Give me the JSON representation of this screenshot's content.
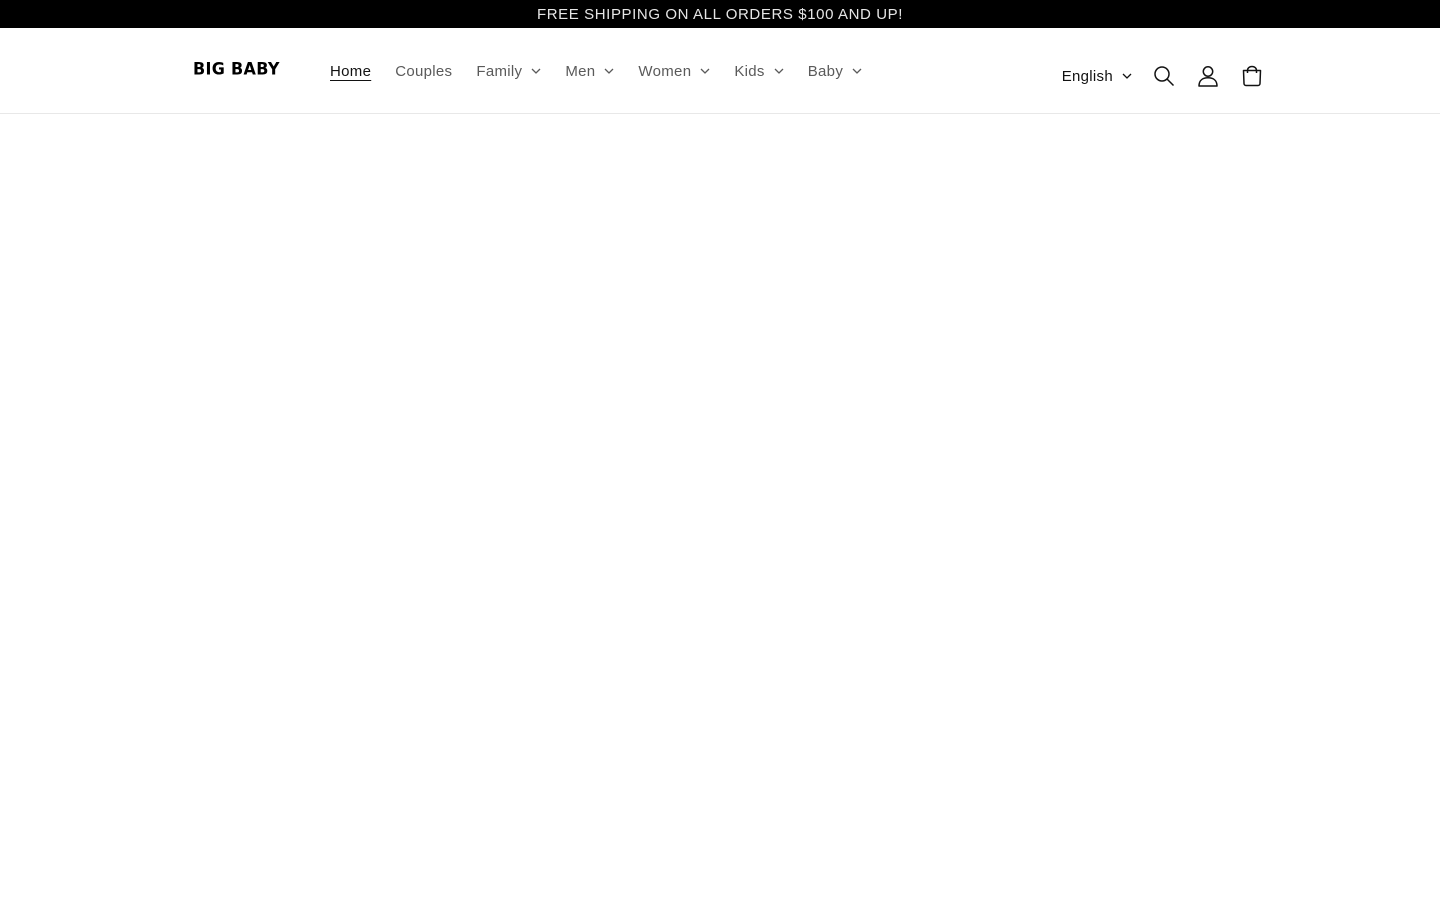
{
  "announcement": {
    "text": "FREE SHIPPING ON ALL ORDERS $100 AND UP!"
  },
  "header": {
    "logo_text": "BIG BABY",
    "nav": [
      {
        "label": "Home"
      },
      {
        "label": "Couples"
      },
      {
        "label": "Family"
      },
      {
        "label": "Men"
      },
      {
        "label": "Women"
      },
      {
        "label": "Kids"
      },
      {
        "label": "Baby"
      }
    ],
    "language": {
      "selected": "English"
    },
    "icons": {
      "search": "search-icon",
      "account": "account-icon",
      "cart": "cart-icon"
    }
  },
  "colors": {
    "announcement_bg": "#000000",
    "announcement_text": "#e6e6e6",
    "nav_text": "#5a5a5a",
    "active_text": "#121212"
  }
}
